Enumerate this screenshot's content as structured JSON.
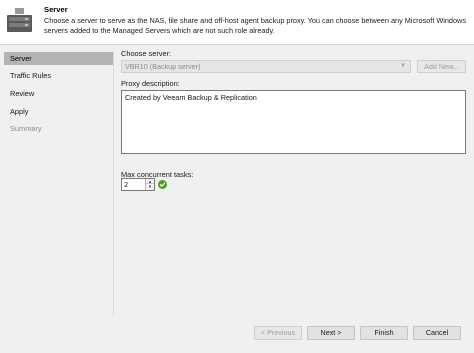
{
  "header": {
    "title": "Server",
    "description": "Choose a server to serve as the NAS, file share and off-host agent backup proxy. You can choose between any Microsoft Windows servers added to the Managed Servers which are not such role already."
  },
  "nav": {
    "items": [
      {
        "label": "Server",
        "state": "active"
      },
      {
        "label": "Traffic Rules",
        "state": "normal"
      },
      {
        "label": "Review",
        "state": "normal"
      },
      {
        "label": "Apply",
        "state": "normal"
      },
      {
        "label": "Summary",
        "state": "disabled"
      }
    ]
  },
  "form": {
    "choose_server_label": "Choose server:",
    "server_value": "VBR10 (Backup server)",
    "add_new_label": "Add New...",
    "proxy_description_label": "Proxy description:",
    "proxy_description_value": "Created by Veeam Backup & Replication",
    "max_tasks_label": "Max concurrent tasks:",
    "max_tasks_value": "2"
  },
  "footer": {
    "previous_label": "< Previous",
    "next_label": "Next >",
    "finish_label": "Finish",
    "cancel_label": "Cancel"
  },
  "icons": {
    "header": "server-wizard-icon",
    "status": "check-ok-icon"
  },
  "colors": {
    "accent": "#4f9b2a",
    "active_nav": "#b4b4b4",
    "header_icon": "#4a4a4a"
  }
}
